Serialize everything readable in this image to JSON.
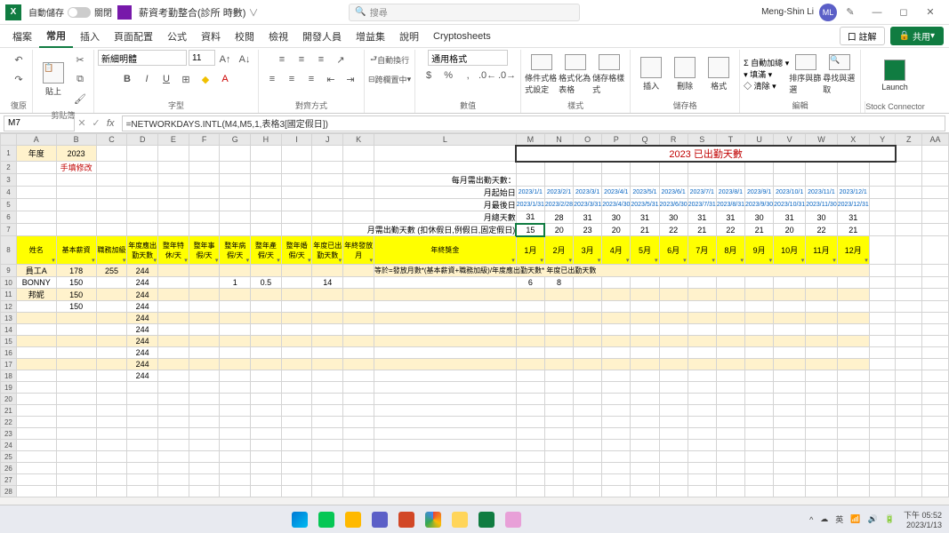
{
  "titlebar": {
    "autosave_label": "自動儲存",
    "autosave_state": "關閉",
    "filename": "薪資考勤整合(診所 時數)",
    "search_placeholder": "搜尋",
    "username": "Meng-Shin Li",
    "avatar": "ML"
  },
  "menu": {
    "file": "檔案",
    "home": "常用",
    "insert": "插入",
    "layout": "頁面配置",
    "formulas": "公式",
    "data": "資料",
    "review": "校閱",
    "view": "檢視",
    "developer": "開發人員",
    "addins": "增益集",
    "help": "說明",
    "crypto": "Cryptosheets",
    "comment_btn": "口 註解",
    "share": "共用"
  },
  "ribbon": {
    "undo": "復原",
    "clipboard": "剪貼簿",
    "paste": "貼上",
    "font": "字型",
    "font_name": "新細明體",
    "font_size": "11",
    "alignment": "對齊方式",
    "wrap": "自動換行",
    "merge": "跨欄置中",
    "number": "數值",
    "format_general": "通用格式",
    "styles": "樣式",
    "cond_fmt": "條件式格式設定",
    "fmt_table": "格式化為表格",
    "cell_styles": "儲存格樣式",
    "cells": "儲存格",
    "insertc": "插入",
    "deletec": "刪除",
    "formatc": "格式",
    "editing": "編輯",
    "autosum": "自動加總",
    "fill": "填滿",
    "clear": "清除",
    "sort": "排序與篩選",
    "find": "尋找與選取",
    "launch": "Launch",
    "connector": "Stock Connector"
  },
  "namebox": "M7",
  "formula": "=NETWORKDAYS.INTL(M4,M5,1,表格3[國定假日])",
  "col_letters": [
    "A",
    "B",
    "C",
    "D",
    "E",
    "F",
    "G",
    "H",
    "I",
    "J",
    "K",
    "L",
    "M",
    "N",
    "O",
    "P",
    "Q",
    "R",
    "S",
    "T",
    "U",
    "V",
    "W",
    "X",
    "Y",
    "Z",
    "AA"
  ],
  "rows": {
    "r1": {
      "A": "年度",
      "B": "2023",
      "title": "2023 已出勤天數"
    },
    "r2": {
      "B": "手填修改"
    },
    "r3": {
      "L": "每月需出勤天數："
    },
    "r4": {
      "L": "月起始日",
      "dates": [
        "2023/1/1",
        "2023/2/1",
        "2023/3/1",
        "2023/4/1",
        "2023/5/1",
        "2023/6/1",
        "2023/7/1",
        "2023/8/1",
        "2023/9/1",
        "2023/10/1",
        "2023/11/1",
        "2023/12/1"
      ]
    },
    "r5": {
      "L": "月最後日",
      "dates": [
        "2023/1/31",
        "2023/2/28",
        "2023/3/31",
        "2023/4/30",
        "2023/5/31",
        "2023/6/30",
        "2023/7/31",
        "2023/8/31",
        "2023/9/30",
        "2023/10/31",
        "2023/11/30",
        "2023/12/31"
      ]
    },
    "r6": {
      "L": "月總天數",
      "vals": [
        "31",
        "28",
        "31",
        "30",
        "31",
        "30",
        "31",
        "31",
        "30",
        "31",
        "30",
        "31"
      ]
    },
    "r7": {
      "L": "月需出勤天數 (扣休假日,例假日,固定假日)",
      "vals": [
        "15",
        "20",
        "23",
        "20",
        "21",
        "22",
        "21",
        "22",
        "21",
        "20",
        "22",
        "21"
      ]
    },
    "r8": {
      "headers": [
        "姓名",
        "基本薪資",
        "職務加級",
        "年度應出勤天數",
        "整年特休/天",
        "整年事假/天",
        "整年病假/天",
        "整年產假/天",
        "整年婚假/天",
        "年度已出勤天數",
        "年終發放月",
        "年終獎金"
      ],
      "months": [
        "1月",
        "2月",
        "3月",
        "4月",
        "5月",
        "6月",
        "7月",
        "8月",
        "9月",
        "10月",
        "11月",
        "12月"
      ]
    },
    "r9": {
      "A": "員工A",
      "B": "178",
      "C": "255",
      "D": "244",
      "L": "等於=發放月數*(基本薪資+職務加級)/年度應出勤天數* 年度已出勤天數"
    },
    "r10": {
      "A": "BONNY",
      "B": "150",
      "D": "244",
      "G": "1",
      "H": "0.5",
      "J": "14",
      "M": "6",
      "N": "8"
    },
    "r11": {
      "A": "邦妮",
      "B": "150",
      "D": "244"
    },
    "r12": {
      "B": "150",
      "D": "244"
    },
    "fill_d": "244"
  },
  "taskbar": {
    "time": "下午 05:52",
    "date": "2023/1/13",
    "lang": "英"
  }
}
